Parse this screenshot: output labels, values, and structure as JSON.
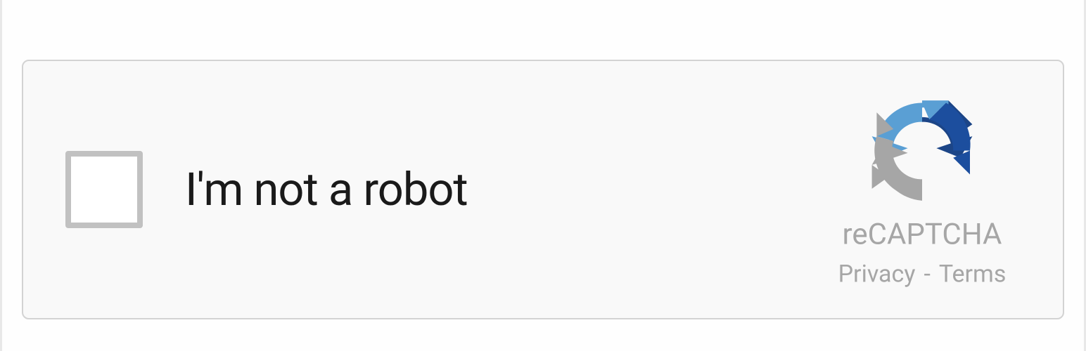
{
  "captcha": {
    "label": "I'm not a robot",
    "brand": "reCAPTCHA",
    "privacy": "Privacy",
    "terms": "Terms",
    "separator": "-"
  }
}
